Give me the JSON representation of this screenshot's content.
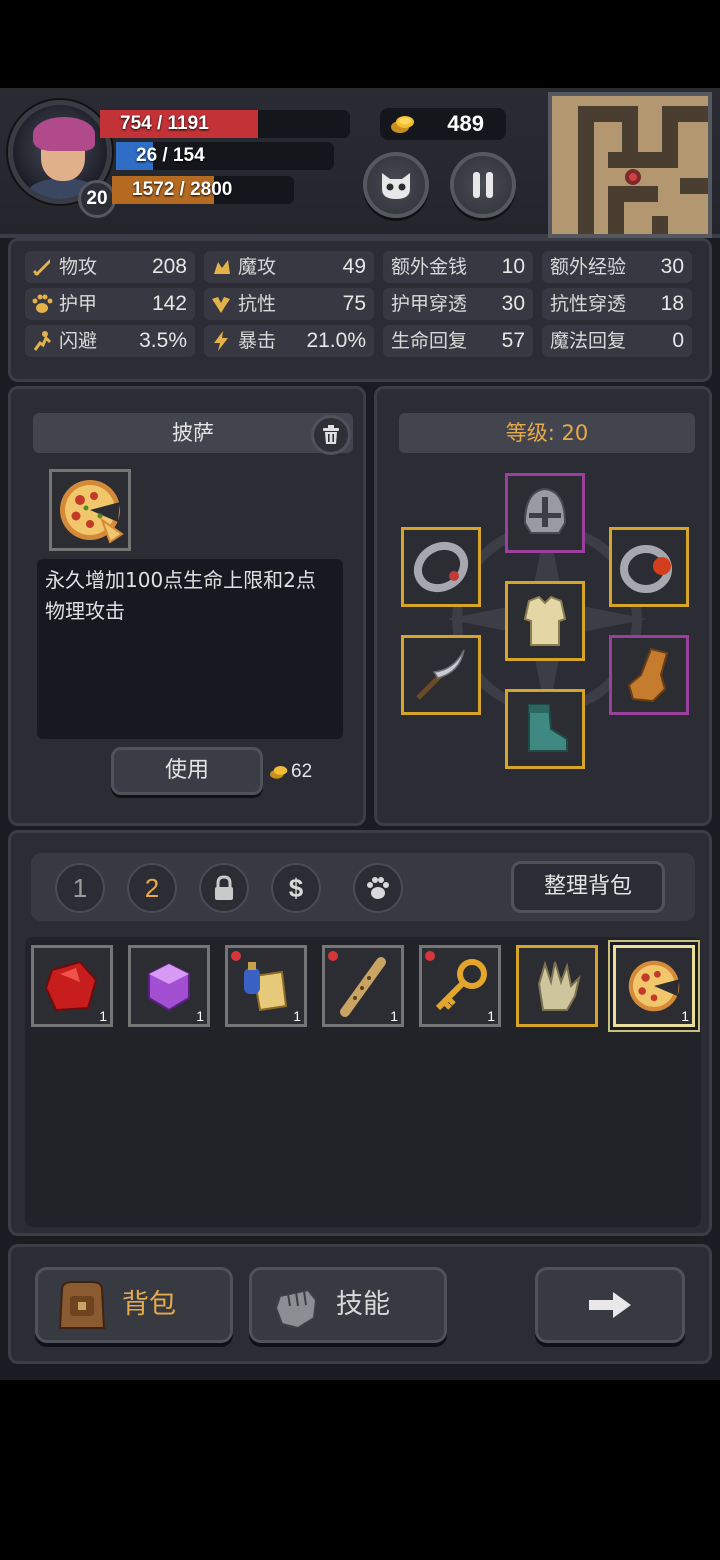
{
  "player": {
    "level": "20",
    "hp": "754 / 1191",
    "hp_fraction": 0.633,
    "mp": "26 / 154",
    "mp_fraction": 0.169,
    "xp": "1572 / 2800",
    "xp_fraction": 0.561,
    "gold": "489"
  },
  "stats": [
    {
      "label": "物攻",
      "value": "208",
      "icon": "sword-icon"
    },
    {
      "label": "魔攻",
      "value": "49",
      "icon": "magic-hand-icon"
    },
    {
      "label": "额外金钱",
      "value": "10",
      "icon": ""
    },
    {
      "label": "额外经验",
      "value": "30",
      "icon": ""
    },
    {
      "label": "护甲",
      "value": "142",
      "icon": "paw-shield-icon"
    },
    {
      "label": "抗性",
      "value": "75",
      "icon": "resist-icon"
    },
    {
      "label": "护甲穿透",
      "value": "30",
      "icon": ""
    },
    {
      "label": "抗性穿透",
      "value": "18",
      "icon": ""
    },
    {
      "label": "闪避",
      "value": "3.5%",
      "icon": "running-icon"
    },
    {
      "label": "暴击",
      "value": "21.0%",
      "icon": "lightning-icon"
    },
    {
      "label": "生命回复",
      "value": "57",
      "icon": ""
    },
    {
      "label": "魔法回复",
      "value": "0",
      "icon": ""
    }
  ],
  "item": {
    "name": "披萨",
    "description": "永久增加100点生命上限和2点物理攻击",
    "use_label": "使用",
    "price": "62"
  },
  "equipment": {
    "level_label": "等级: 20"
  },
  "bag": {
    "tabs": [
      "1",
      "2"
    ],
    "active_tab": "2",
    "sort_label": "整理背包",
    "slots": [
      {
        "item": "red-gem",
        "qty": "1"
      },
      {
        "item": "purple-gem",
        "qty": "1"
      },
      {
        "item": "scroll-potion",
        "qty": "1"
      },
      {
        "item": "flute",
        "qty": "1"
      },
      {
        "item": "golden-key",
        "qty": "1"
      },
      {
        "item": "glove",
        "qty": ""
      },
      {
        "item": "pizza",
        "qty": "1"
      }
    ]
  },
  "nav": {
    "bag_label": "背包",
    "skill_label": "技能"
  },
  "colors": {
    "hp": "#c23237",
    "mp": "#2f6ec4",
    "xp": "#b56a22",
    "accent": "#e6a94b",
    "legendary_border": "#d6a528",
    "epic_border": "#9a3f9c"
  }
}
